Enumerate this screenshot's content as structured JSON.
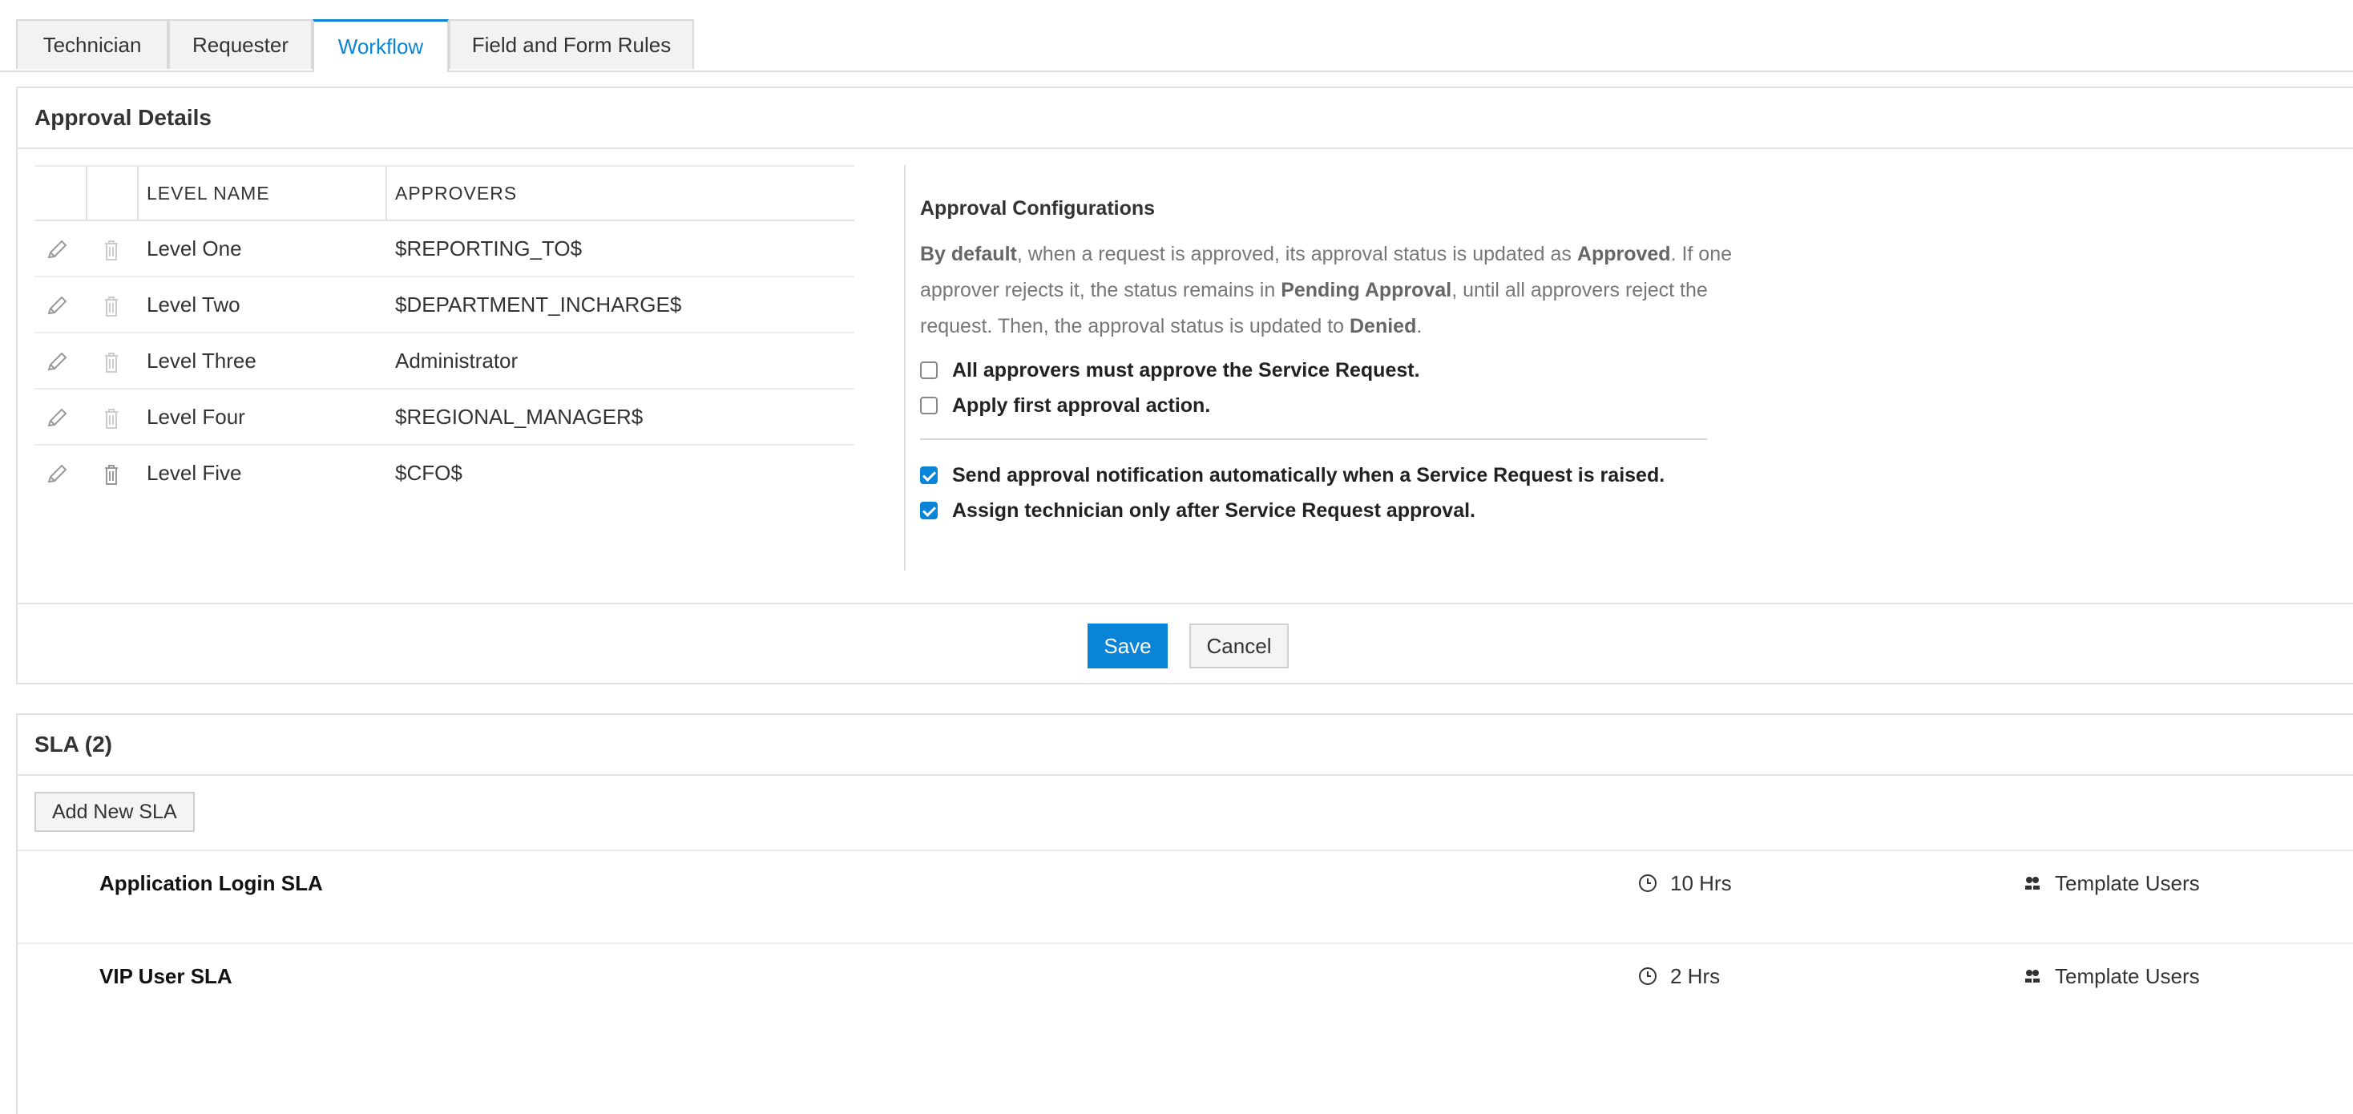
{
  "tabs": [
    {
      "label": "Technician"
    },
    {
      "label": "Requester"
    },
    {
      "label": "Workflow"
    },
    {
      "label": "Field and Form Rules"
    }
  ],
  "approval": {
    "title": "Approval Details",
    "columns": {
      "level_name": "LEVEL NAME",
      "approvers": "APPROVERS"
    },
    "levels": [
      {
        "name": "Level One",
        "approver": "$REPORTING_TO$"
      },
      {
        "name": "Level Two",
        "approver": "$DEPARTMENT_INCHARGE$"
      },
      {
        "name": "Level Three",
        "approver": "Administrator"
      },
      {
        "name": "Level Four",
        "approver": "$REGIONAL_MANAGER$"
      },
      {
        "name": "Level Five",
        "approver": "$CFO$"
      }
    ],
    "config": {
      "title": "Approval Configurations",
      "desc": {
        "p1_bold": "By default",
        "p1": ", when a request is approved, its approval status is updated as ",
        "approved": "Approved",
        "p2": ". If one approver rejects it, the status remains in ",
        "pending": "Pending Approval",
        "p3": ", until all approvers reject the request. Then, the approval status is updated to ",
        "denied": "Denied",
        "p4": "."
      },
      "options": [
        {
          "label": "All approvers must approve the Service Request.",
          "checked": false
        },
        {
          "label": "Apply first approval action.",
          "checked": false
        },
        {
          "label": "Send approval notification automatically when a Service Request is raised.",
          "checked": true
        },
        {
          "label": "Assign technician only after Service Request approval.",
          "checked": true
        }
      ]
    },
    "save_label": "Save",
    "cancel_label": "Cancel"
  },
  "sla": {
    "title": "SLA (2)",
    "add_label": "Add New SLA",
    "items": [
      {
        "name": "Application Login SLA",
        "time": "10 Hrs",
        "users": "Template Users"
      },
      {
        "name": "VIP User SLA",
        "time": "2 Hrs",
        "users": "Template Users"
      }
    ]
  },
  "colors": {
    "accent": "#0a84d6"
  }
}
